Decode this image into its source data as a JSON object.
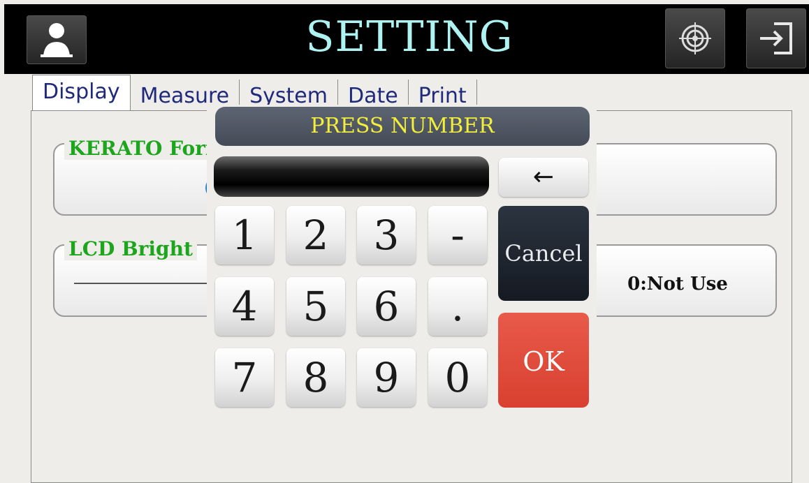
{
  "header": {
    "title": "SETTING",
    "icons": {
      "left": "user-icon",
      "right1": "target-icon",
      "right2": "exit-icon"
    }
  },
  "tabs": [
    {
      "label": "Display"
    },
    {
      "label": "Measure"
    },
    {
      "label": "System"
    },
    {
      "label": "Date"
    },
    {
      "label": "Print"
    }
  ],
  "groups": {
    "kerato": {
      "label": "KERATO Form",
      "fragment": "("
    },
    "lcd": {
      "label": "LCD Bright",
      "value": "0:Not Use"
    }
  },
  "keypad": {
    "title": "PRESS NUMBER",
    "display_value": "",
    "backspace": "←",
    "keys": [
      "1",
      "2",
      "3",
      "-",
      "4",
      "5",
      "6",
      ".",
      "7",
      "8",
      "9",
      "0"
    ],
    "cancel": "Cancel",
    "ok": "OK"
  },
  "colors": {
    "header_bg": "#000000",
    "title": "#aef3f2",
    "group_label": "#1ea51e",
    "keypad_title_text": "#f2ee3a",
    "ok_bg": "#e0483a",
    "cancel_bg": "#1f2630"
  }
}
